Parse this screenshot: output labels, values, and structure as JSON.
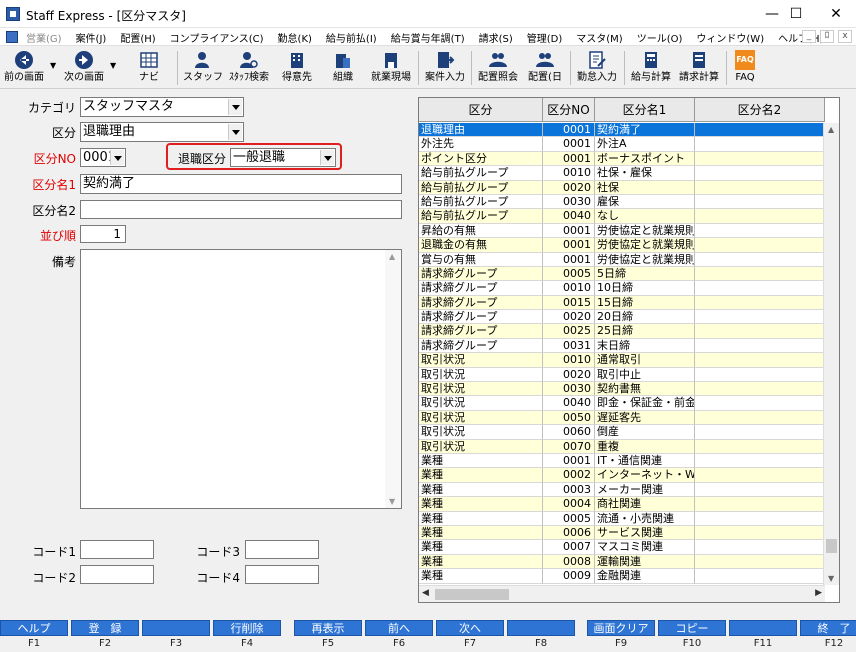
{
  "window": {
    "title": "Staff Express - [区分マスタ]",
    "controls": {
      "minimize": "—",
      "maximize": "☐",
      "close": "✕"
    }
  },
  "menu": {
    "items": [
      {
        "label": "営業(G)",
        "disabled": true
      },
      {
        "label": "案件(J)",
        "disabled": false
      },
      {
        "label": "配置(H)",
        "disabled": false
      },
      {
        "label": "コンプライアンス(C)",
        "disabled": false
      },
      {
        "label": "勤怠(K)",
        "disabled": false
      },
      {
        "label": "給与前払(I)",
        "disabled": false
      },
      {
        "label": "給与賞与年調(T)",
        "disabled": false
      },
      {
        "label": "請求(S)",
        "disabled": false
      },
      {
        "label": "管理(D)",
        "disabled": false
      },
      {
        "label": "マスタ(M)",
        "disabled": false
      },
      {
        "label": "ツール(O)",
        "disabled": false
      },
      {
        "label": "ウィンドウ(W)",
        "disabled": false
      },
      {
        "label": "ヘルプ(H)",
        "disabled": false
      }
    ],
    "mdi": [
      "_",
      "ﾛ",
      "x"
    ]
  },
  "toolbar": {
    "prev": "前の画面",
    "next": "次の画面",
    "navi": "ナビ",
    "staff": "スタッフ",
    "staff_search": "ｽﾀｯﾌ検索",
    "client": "得意先",
    "org": "組織",
    "worksite": "就業現場",
    "case_input": "案件入力",
    "placement_ref": "配置照会",
    "placement_day": "配置(日",
    "attendance": "勤怠入力",
    "payroll": "給与計算",
    "billing": "請求計算",
    "faq": "FAQ",
    "faq_icon_text": "FAQ"
  },
  "form": {
    "category_label": "カテゴリ",
    "category_value": "スタッフマスタ",
    "kubun_label": "区分",
    "kubun_value": "退職理由",
    "kubun_no_label": "区分NO",
    "kubun_no_value": "0001",
    "retire_label": "退職区分",
    "retire_value": "一般退職",
    "name1_label": "区分名1",
    "name1_value": "契約満了",
    "name2_label": "区分名2",
    "name2_value": "",
    "order_label": "並び順",
    "order_value": "1",
    "memo_label": "備考",
    "code1_label": "コード1",
    "code2_label": "コード2",
    "code3_label": "コード3",
    "code4_label": "コード4"
  },
  "grid": {
    "headers": [
      "区分",
      "区分NO",
      "区分名1",
      "区分名2"
    ],
    "rows": [
      {
        "kubun": "退職理由",
        "no": "0001",
        "name1": "契約満了",
        "name2": "",
        "style": "selected"
      },
      {
        "kubun": "外注先",
        "no": "0001",
        "name1": "外注A",
        "name2": "",
        "style": "white"
      },
      {
        "kubun": "ポイント区分",
        "no": "0001",
        "name1": "ボーナスポイント",
        "name2": "",
        "style": "yellow"
      },
      {
        "kubun": "給与前払グループ",
        "no": "0010",
        "name1": "社保・雇保",
        "name2": "",
        "style": "white"
      },
      {
        "kubun": "給与前払グループ",
        "no": "0020",
        "name1": "社保",
        "name2": "",
        "style": "yellow"
      },
      {
        "kubun": "給与前払グループ",
        "no": "0030",
        "name1": "雇保",
        "name2": "",
        "style": "white"
      },
      {
        "kubun": "給与前払グループ",
        "no": "0040",
        "name1": "なし",
        "name2": "",
        "style": "yellow"
      },
      {
        "kubun": "昇給の有無",
        "no": "0001",
        "name1": "労使協定と就業規則に",
        "name2": "",
        "style": "white"
      },
      {
        "kubun": "退職金の有無",
        "no": "0001",
        "name1": "労使協定と就業規則に",
        "name2": "",
        "style": "yellow"
      },
      {
        "kubun": "賞与の有無",
        "no": "0001",
        "name1": "労使協定と就業規則に",
        "name2": "",
        "style": "white"
      },
      {
        "kubun": "請求締グループ",
        "no": "0005",
        "name1": "5日締",
        "name2": "",
        "style": "yellow"
      },
      {
        "kubun": "請求締グループ",
        "no": "0010",
        "name1": "10日締",
        "name2": "",
        "style": "white"
      },
      {
        "kubun": "請求締グループ",
        "no": "0015",
        "name1": "15日締",
        "name2": "",
        "style": "yellow"
      },
      {
        "kubun": "請求締グループ",
        "no": "0020",
        "name1": "20日締",
        "name2": "",
        "style": "white"
      },
      {
        "kubun": "請求締グループ",
        "no": "0025",
        "name1": "25日締",
        "name2": "",
        "style": "yellow"
      },
      {
        "kubun": "請求締グループ",
        "no": "0031",
        "name1": "末日締",
        "name2": "",
        "style": "white"
      },
      {
        "kubun": "取引状況",
        "no": "0010",
        "name1": "通常取引",
        "name2": "",
        "style": "yellow"
      },
      {
        "kubun": "取引状況",
        "no": "0020",
        "name1": "取引中止",
        "name2": "",
        "style": "white"
      },
      {
        "kubun": "取引状況",
        "no": "0030",
        "name1": "契約書無",
        "name2": "",
        "style": "yellow"
      },
      {
        "kubun": "取引状況",
        "no": "0040",
        "name1": "即金・保証金・前金",
        "name2": "",
        "style": "white"
      },
      {
        "kubun": "取引状況",
        "no": "0050",
        "name1": "遅延客先",
        "name2": "",
        "style": "yellow"
      },
      {
        "kubun": "取引状況",
        "no": "0060",
        "name1": "倒産",
        "name2": "",
        "style": "white"
      },
      {
        "kubun": "取引状況",
        "no": "0070",
        "name1": "重複",
        "name2": "",
        "style": "yellow"
      },
      {
        "kubun": "業種",
        "no": "0001",
        "name1": "IT・通信関連",
        "name2": "",
        "style": "white"
      },
      {
        "kubun": "業種",
        "no": "0002",
        "name1": "インターネット・Webl",
        "name2": "",
        "style": "yellow"
      },
      {
        "kubun": "業種",
        "no": "0003",
        "name1": "メーカー関連",
        "name2": "",
        "style": "white"
      },
      {
        "kubun": "業種",
        "no": "0004",
        "name1": "商社関連",
        "name2": "",
        "style": "yellow"
      },
      {
        "kubun": "業種",
        "no": "0005",
        "name1": "流通・小売関連",
        "name2": "",
        "style": "white"
      },
      {
        "kubun": "業種",
        "no": "0006",
        "name1": "サービス関連",
        "name2": "",
        "style": "yellow"
      },
      {
        "kubun": "業種",
        "no": "0007",
        "name1": "マスコミ関連",
        "name2": "",
        "style": "white"
      },
      {
        "kubun": "業種",
        "no": "0008",
        "name1": "運輸関連",
        "name2": "",
        "style": "yellow"
      },
      {
        "kubun": "業種",
        "no": "0009",
        "name1": "金融関連",
        "name2": "",
        "style": "white"
      }
    ]
  },
  "fkeys": [
    {
      "label": "ヘルプ",
      "key": "F1"
    },
    {
      "label": "登　録",
      "key": "F2"
    },
    {
      "label": "",
      "key": "F3"
    },
    {
      "label": "行削除",
      "key": "F4"
    },
    {
      "label": "再表示",
      "key": "F5"
    },
    {
      "label": "前へ",
      "key": "F6"
    },
    {
      "label": "次へ",
      "key": "F7"
    },
    {
      "label": "",
      "key": "F8"
    },
    {
      "label": "画面クリア",
      "key": "F9"
    },
    {
      "label": "コピー",
      "key": "F10"
    },
    {
      "label": "",
      "key": "F11"
    },
    {
      "label": "終　了",
      "key": "F12"
    }
  ],
  "colors": {
    "accent": "#2e74d4",
    "selected_row": "#0a74da",
    "stripe": "#ffffd8",
    "required_label": "#e00000",
    "highlight": "#e02020"
  }
}
